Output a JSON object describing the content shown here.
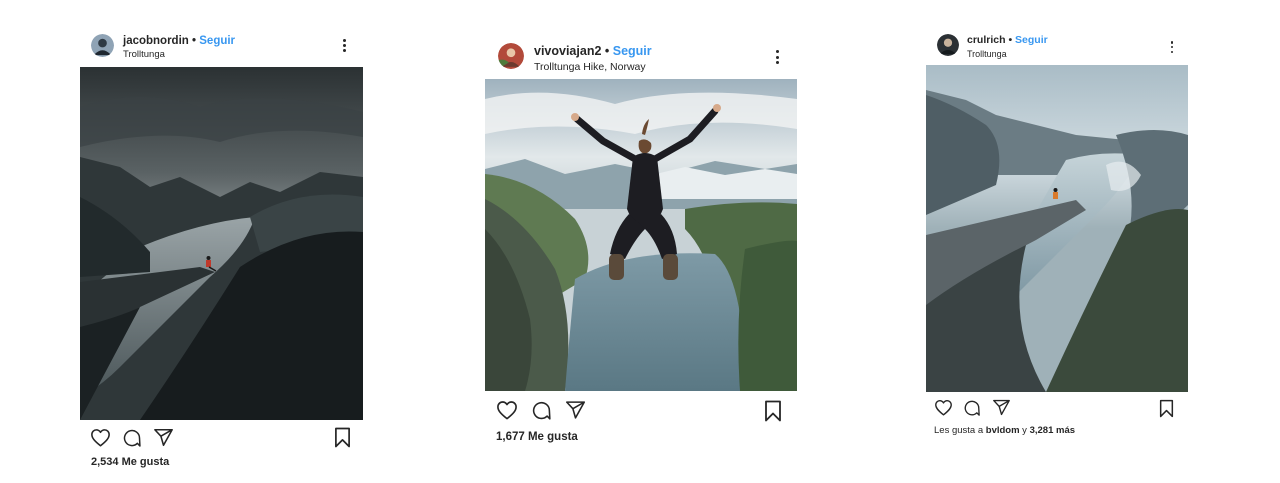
{
  "posts": [
    {
      "username": "jacobnordin",
      "separator": "•",
      "follow_label": "Seguir",
      "location": "Trolltunga",
      "likes_text": "2,534 Me gusta",
      "photo_subject": "person sitting on cliff over fjord, dark moody sky"
    },
    {
      "username": "vivoviajan2",
      "separator": "•",
      "follow_label": "Seguir",
      "location": "Trolltunga Hike, Norway",
      "likes_text": "1,677 Me gusta",
      "photo_subject": "woman jumping above fjord valley"
    },
    {
      "username": "crulrich",
      "separator": "•",
      "follow_label": "Seguir",
      "location": "Trolltunga",
      "likes_prefix": "Les gusta a ",
      "likes_user": "bvldom",
      "likes_middle": " y ",
      "likes_count": "3,281 más",
      "photo_subject": "person sitting on rock tongue over misty fjord"
    }
  ],
  "icons": {
    "like": "heart-outline-icon",
    "comment": "comment-bubble-icon",
    "share": "paper-plane-icon",
    "save": "bookmark-outline-icon",
    "more": "vertical-ellipsis-icon"
  },
  "colors": {
    "text": "#262626",
    "follow_link": "#3897f0",
    "background": "#ffffff"
  }
}
